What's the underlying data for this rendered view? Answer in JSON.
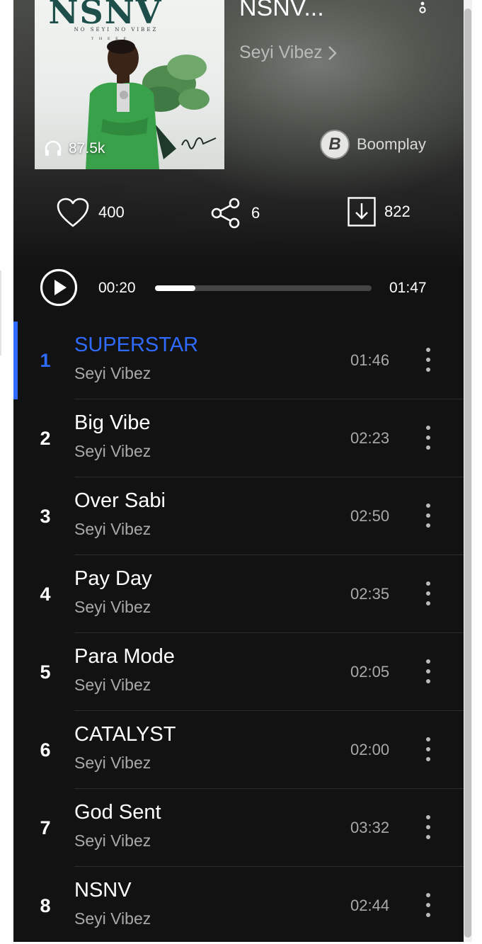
{
  "album": {
    "title": "NSNV...",
    "artist": "Seyi Vibez",
    "plays": "87.5k",
    "brand": "Boomplay",
    "brand_initial": "B",
    "cover_title": "NSNV",
    "cover_subtitle": "NO   SEYI   NO   VIBEZ",
    "cover_subtitle_small": "T H E   E P"
  },
  "stats": {
    "likes": "400",
    "shares": "6",
    "downloads": "822"
  },
  "player": {
    "current_time": "00:20",
    "total_time": "01:47",
    "progress_fraction": 0.187
  },
  "tracks": [
    {
      "number": "1",
      "title": "SUPERSTAR",
      "artist": "Seyi Vibez",
      "duration": "01:46",
      "active": true
    },
    {
      "number": "2",
      "title": "Big Vibe",
      "artist": "Seyi Vibez",
      "duration": "02:23",
      "active": false
    },
    {
      "number": "3",
      "title": "Over Sabi",
      "artist": "Seyi Vibez",
      "duration": "02:50",
      "active": false
    },
    {
      "number": "4",
      "title": "Pay Day",
      "artist": "Seyi Vibez",
      "duration": "02:35",
      "active": false
    },
    {
      "number": "5",
      "title": "Para Mode",
      "artist": "Seyi Vibez",
      "duration": "02:05",
      "active": false
    },
    {
      "number": "6",
      "title": "CATALYST",
      "artist": "Seyi Vibez",
      "duration": "02:00",
      "active": false
    },
    {
      "number": "7",
      "title": "God Sent",
      "artist": "Seyi Vibez",
      "duration": "03:32",
      "active": false
    },
    {
      "number": "8",
      "title": "NSNV",
      "artist": "Seyi Vibez",
      "duration": "02:44",
      "active": false
    }
  ],
  "colors": {
    "accent": "#2f6bff",
    "background": "#121212",
    "muted_text": "#a9aaa8"
  }
}
